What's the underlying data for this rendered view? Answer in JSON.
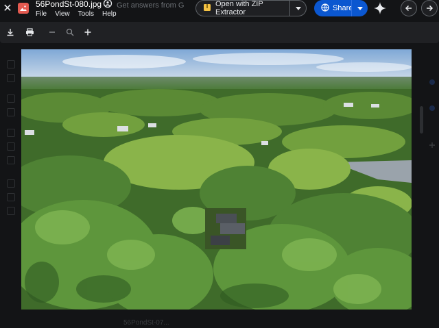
{
  "window": {
    "title": "56PondSt-080.jpg",
    "menus": [
      "File",
      "View",
      "Tools",
      "Help"
    ],
    "ghost_tab_text": "Get answers from G"
  },
  "actions": {
    "open_with_label": "Open with ZIP Extractor",
    "share_label": "Share"
  },
  "toolbar": {
    "icons": [
      "download-icon",
      "print-icon",
      "zoom-out-icon",
      "zoom-icon",
      "zoom-in-icon"
    ]
  },
  "footer": {
    "ghost_text": "56PondSt-07..."
  },
  "colors": {
    "background": "#131416",
    "toolbar": "#202124",
    "share_accent": "#0b57d0",
    "photo_icon": "#e45a50"
  }
}
